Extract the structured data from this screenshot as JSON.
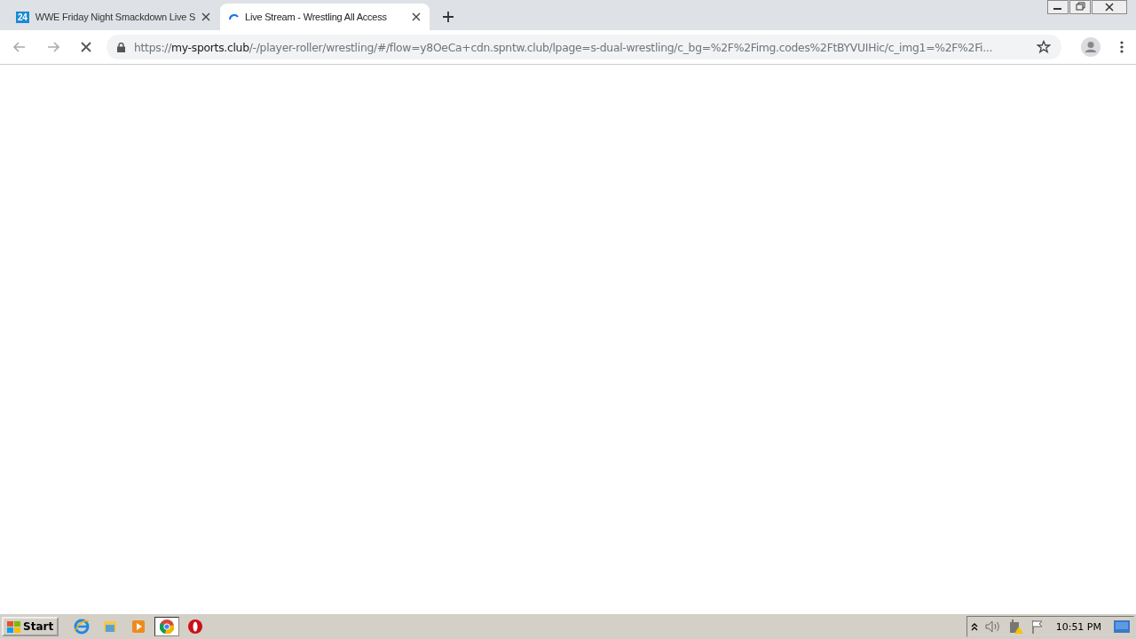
{
  "tabs": [
    {
      "favicon": "24",
      "title": "WWE Friday Night Smackdown Live S",
      "selected": false,
      "loading": false
    },
    {
      "title": "Live Stream - Wrestling All Access",
      "selected": true,
      "loading": true
    }
  ],
  "address_bar": {
    "scheme": "https://",
    "host": "my-sports.club",
    "rest": "/-/player-roller/wrestling/#/flow=y8OeCa+cdn.spntw.club/lpage=s-dual-wrestling/c_bg=%2F%2Fimg.codes%2FtBYVUIHic/c_img1=%2F%2Fi...",
    "loading": true
  },
  "taskbar": {
    "start": "Start",
    "clock": "10:51 PM",
    "apps": [
      {
        "kind": "ie",
        "selected": false
      },
      {
        "kind": "folder",
        "selected": false
      },
      {
        "kind": "media",
        "selected": false
      },
      {
        "kind": "chrome",
        "selected": true
      },
      {
        "kind": "opera",
        "selected": false
      }
    ]
  }
}
